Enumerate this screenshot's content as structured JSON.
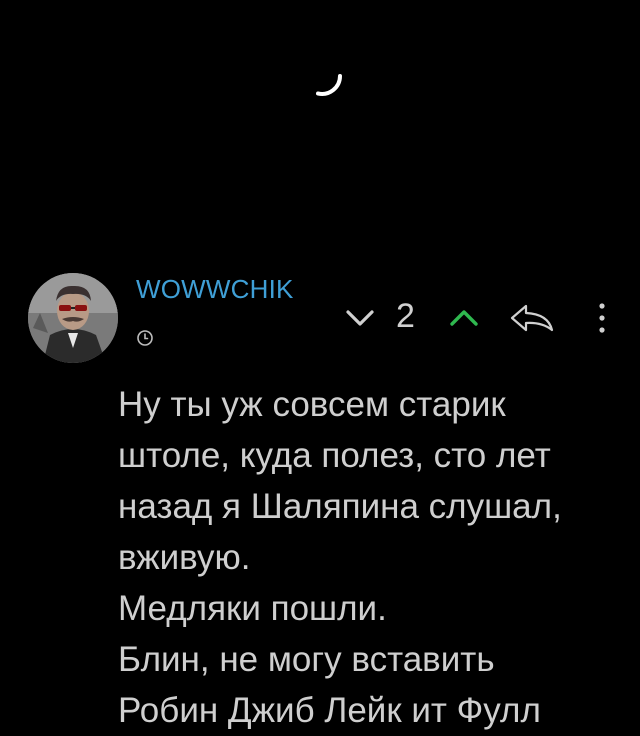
{
  "comment": {
    "username": "WOWWCHIK",
    "score": "2",
    "text": [
      "Ну ты уж совсем старик штоле, куда полез, сто лет назад я Шаляпина слушал, вживую.",
      "Медляки пошли.",
      "Блин, не могу вставить",
      "Робин Джиб Лейк ит Фулл"
    ]
  },
  "icons": {
    "loading": "loading-spinner-icon",
    "time": "clock-icon",
    "downvote": "chevron-down-icon",
    "upvote": "chevron-up-icon",
    "reply": "reply-arrow-icon",
    "more": "more-vertical-icon"
  },
  "colors": {
    "background": "#000000",
    "username": "#3f9fd6",
    "upvote": "#2fb84f",
    "text": "#cfcfcf",
    "icon": "#d0d0d0"
  }
}
